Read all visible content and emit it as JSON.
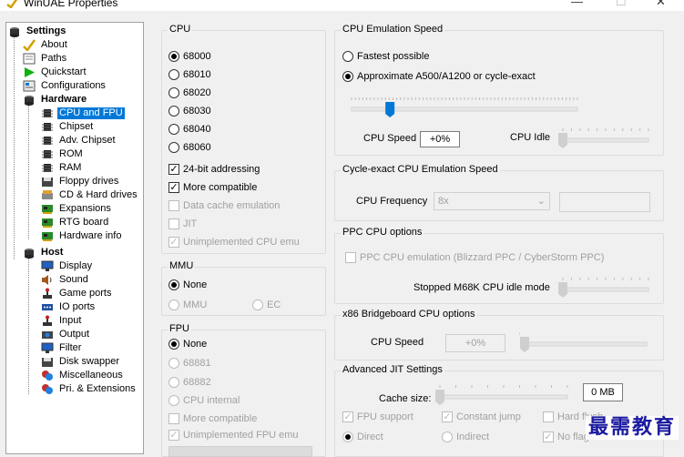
{
  "window": {
    "title": "WinUAE Properties",
    "min": "—",
    "max": "☐",
    "close": "✕"
  },
  "tree": {
    "settings": "Settings",
    "about": "About",
    "paths": "Paths",
    "quickstart": "Quickstart",
    "configurations": "Configurations",
    "hardware": "Hardware",
    "cpu_fpu": "CPU and FPU",
    "chipset": "Chipset",
    "adv_chipset": "Adv. Chipset",
    "rom": "ROM",
    "ram": "RAM",
    "floppy": "Floppy drives",
    "cd_hard": "CD & Hard drives",
    "expansions": "Expansions",
    "rtg": "RTG board",
    "hwinfo": "Hardware info",
    "host": "Host",
    "display": "Display",
    "sound": "Sound",
    "gameports": "Game ports",
    "ioports": "IO ports",
    "input": "Input",
    "output": "Output",
    "filter": "Filter",
    "diskswapper": "Disk swapper",
    "misc": "Miscellaneous",
    "pri": "Pri. & Extensions"
  },
  "cpu": {
    "label": "CPU",
    "options": [
      "68000",
      "68010",
      "68020",
      "68030",
      "68040",
      "68060"
    ],
    "selected": "68000",
    "addr24": "24-bit addressing",
    "more_compat": "More compatible",
    "data_cache": "Data cache emulation",
    "jit": "JIT",
    "unimpl": "Unimplemented CPU emu"
  },
  "mmu": {
    "label": "MMU",
    "none": "None",
    "mmu": "MMU",
    "ec": "EC"
  },
  "fpu": {
    "label": "FPU",
    "none": "None",
    "f68881": "68881",
    "f68882": "68882",
    "internal": "CPU internal",
    "more_compat": "More compatible",
    "unimpl": "Unimplemented FPU emu"
  },
  "speed": {
    "label": "CPU Emulation Speed",
    "fastest": "Fastest possible",
    "approx": "Approximate A500/A1200 or cycle-exact",
    "cpu_speed_label": "CPU Speed",
    "cpu_speed_value": "+0%",
    "cpu_idle_label": "CPU Idle",
    "speed_slider_pos": 0.17,
    "idle_slider_pos": 0.0
  },
  "cycle": {
    "label": "Cycle-exact CPU Emulation Speed",
    "freq_label": "CPU Frequency",
    "freq_value": "8x"
  },
  "ppc": {
    "label": "PPC CPU options",
    "emu": "PPC CPU emulation (Blizzard PPC / CyberStorm PPC)",
    "stopped": "Stopped M68K CPU idle mode"
  },
  "x86": {
    "label": "x86 Bridgeboard CPU options",
    "speed_label": "CPU Speed",
    "speed_value": "+0%"
  },
  "jit": {
    "label": "Advanced JIT Settings",
    "cache_label": "Cache size:",
    "cache_value": "0 MB",
    "fpu_support": "FPU support",
    "const_jump": "Constant jump",
    "hard_flush": "Hard flush",
    "direct": "Direct",
    "indirect": "Indirect",
    "no_flags": "No flags"
  },
  "watermark": "最需教育"
}
